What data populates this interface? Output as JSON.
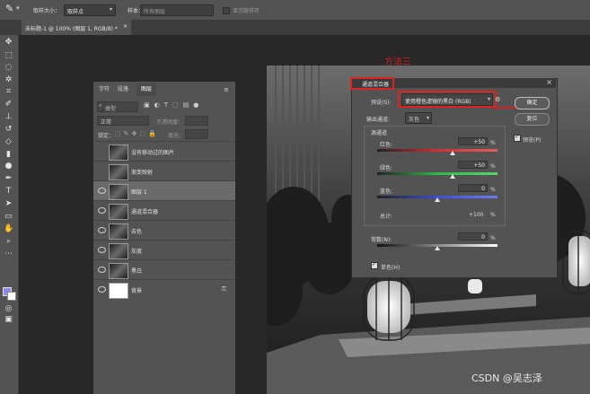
{
  "options_bar": {
    "sample_size_label": "取样大小：",
    "sample_size_value": "取样点",
    "sample_label": "样本：",
    "sample_value": "所有图层",
    "show_ring_label": "显示取样环"
  },
  "document_tab": {
    "title": "未标题-1 @ 100% (图层 1, RGB/8) *",
    "close": "×"
  },
  "annotation": {
    "method_label": "方法三"
  },
  "layers_panel": {
    "tabs": [
      "字符",
      "段落",
      "图层"
    ],
    "search_placeholder": "类型",
    "blend_mode": "正常",
    "opacity_label": "不透明度：",
    "lock_label": "锁定：",
    "fill_label": "填充：",
    "layers": [
      {
        "name": "没有移动过的图片",
        "visible": false
      },
      {
        "name": "渐变映射",
        "visible": false
      },
      {
        "name": "图层 1",
        "visible": true,
        "selected": true
      },
      {
        "name": "通道混合器",
        "visible": true
      },
      {
        "name": "去色",
        "visible": true
      },
      {
        "name": "灰度",
        "visible": true
      },
      {
        "name": "黑白",
        "visible": true
      },
      {
        "name": "背景",
        "visible": true,
        "locked": true
      }
    ]
  },
  "dialog": {
    "title": "通道混合器",
    "preset_label": "预设(S):",
    "preset_value": "使用橙色滤镜的黑白 (RGB)",
    "output_channel_label": "输出通道:",
    "output_channel_value": "灰色",
    "source_channels_label": "源通道",
    "red_label": "红色:",
    "red_value": "+50",
    "green_label": "绿色:",
    "green_value": "+50",
    "blue_label": "蓝色:",
    "blue_value": "0",
    "total_label": "总计:",
    "total_value": "+100",
    "constant_label": "常数(N):",
    "constant_value": "0",
    "monochrome_label": "单色(H)",
    "preview_label": "预览(P)",
    "percent": "%",
    "ok_label": "确定",
    "reset_label": "复位",
    "sliders": {
      "red": 50,
      "green": 50,
      "blue": 0,
      "constant": 0
    },
    "colors": {
      "red": "#d33030",
      "green": "#2fb84a",
      "blue": "#3b4fd8"
    }
  },
  "watermark": "CSDN @吴志泽",
  "colors": {
    "annotation_red": "#d22222",
    "panel": "#535353",
    "background": "#282828"
  }
}
